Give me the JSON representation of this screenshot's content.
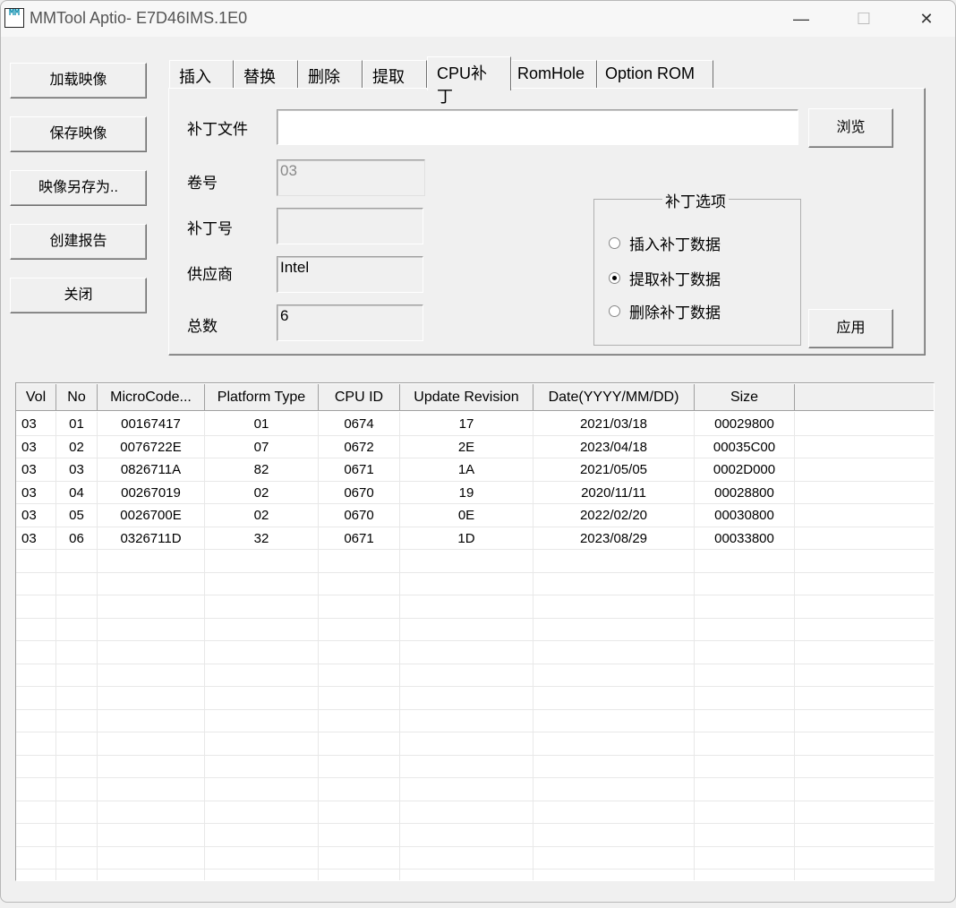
{
  "window": {
    "title": "MMTool Aptio- E7D46IMS.1E0",
    "icon_text": "MM",
    "minimize": "—",
    "maximize": "☐",
    "close": "✕"
  },
  "sidebar": {
    "buttons": [
      "加载映像",
      "保存映像",
      "映像另存为..",
      "创建报告",
      "关闭"
    ]
  },
  "tabs": [
    {
      "label": "插入"
    },
    {
      "label": "替换"
    },
    {
      "label": "删除"
    },
    {
      "label": "提取"
    },
    {
      "label": "CPU补丁",
      "active": true
    },
    {
      "label": "RomHole"
    },
    {
      "label": "Option ROM"
    }
  ],
  "panel": {
    "patch_file_label": "补丁文件",
    "patch_file_value": "",
    "browse": "浏览",
    "volume_label": "卷号",
    "volume_value": "03",
    "patch_no_label": "补丁号",
    "patch_no_value": "",
    "vendor_label": "供应商",
    "vendor_value": "Intel",
    "total_label": "总数",
    "total_value": "6",
    "options_title": "补丁选项",
    "options": [
      {
        "label": "插入补丁数据",
        "selected": false
      },
      {
        "label": "提取补丁数据",
        "selected": true
      },
      {
        "label": "删除补丁数据",
        "selected": false
      }
    ],
    "apply": "应用"
  },
  "table": {
    "columns": [
      "Vol",
      "No",
      "MicroCode...",
      "Platform Type",
      "CPU ID",
      "Update Revision",
      "Date(YYYY/MM/DD)",
      "Size"
    ],
    "rows": [
      [
        "03",
        "01",
        "00167417",
        "01",
        "0674",
        "17",
        "2021/03/18",
        "00029800"
      ],
      [
        "03",
        "02",
        "0076722E",
        "07",
        "0672",
        "2E",
        "2023/04/18",
        "00035C00"
      ],
      [
        "03",
        "03",
        "0826711A",
        "82",
        "0671",
        "1A",
        "2021/05/05",
        "0002D000"
      ],
      [
        "03",
        "04",
        "00267019",
        "02",
        "0670",
        "19",
        "2020/11/11",
        "00028800"
      ],
      [
        "03",
        "05",
        "0026700E",
        "02",
        "0670",
        "0E",
        "2022/02/20",
        "00030800"
      ],
      [
        "03",
        "06",
        "0326711D",
        "32",
        "0671",
        "1D",
        "2023/08/29",
        "00033800"
      ]
    ]
  }
}
